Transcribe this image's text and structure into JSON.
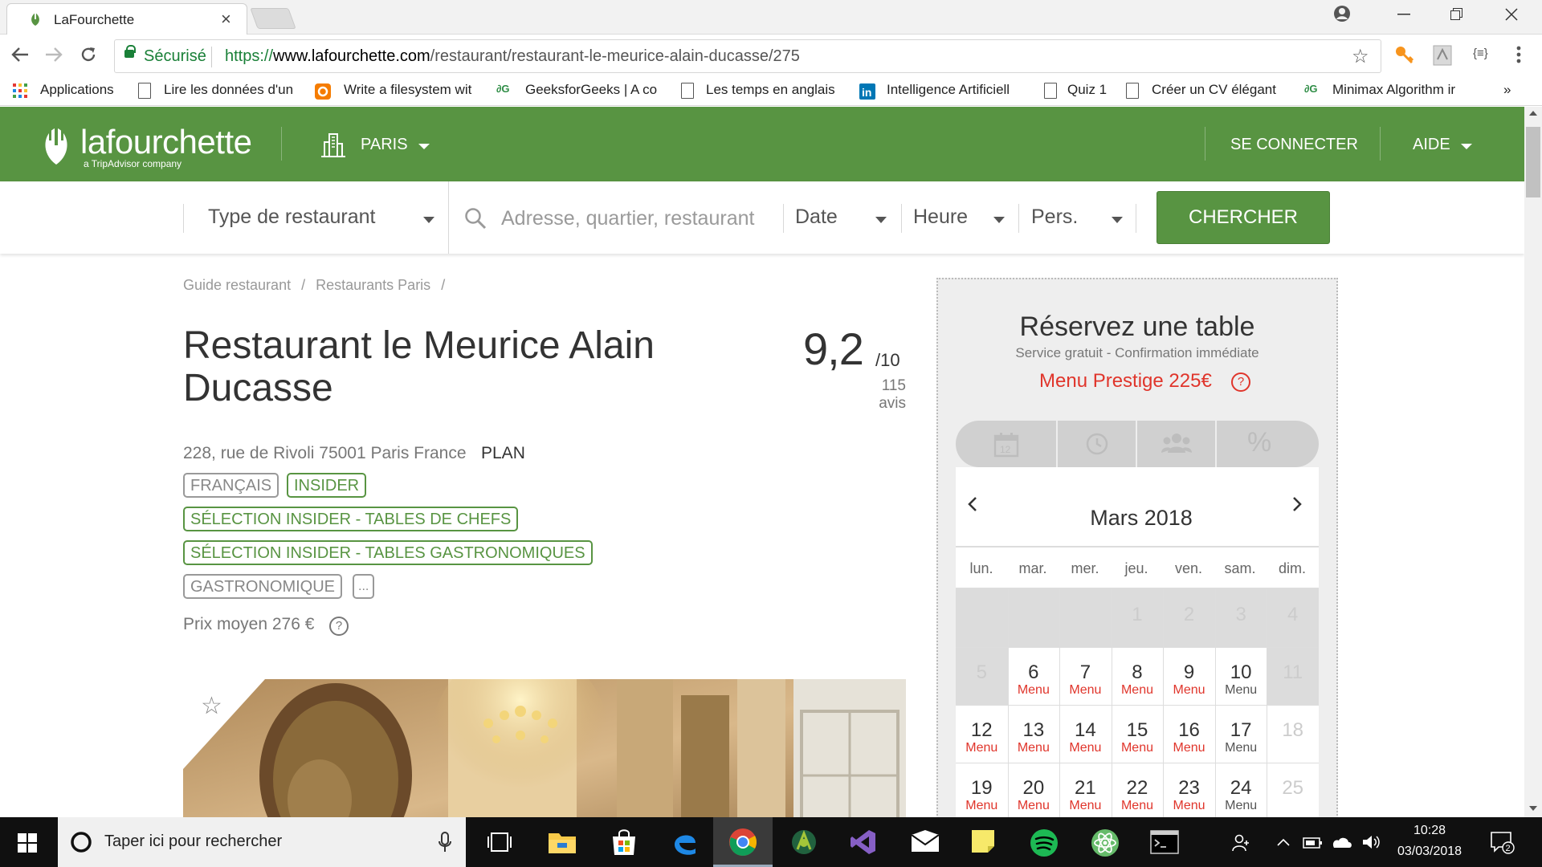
{
  "browser": {
    "tab_title": "LaFourchette",
    "tab_close": "×",
    "secure_label": "Sécurisé",
    "url_scheme": "https://",
    "url_host": "www.lafourchette.com",
    "url_path": "/restaurant/restaurant-le-meurice-alain-ducasse/275",
    "more_bookmarks": "»",
    "bookmarks": [
      {
        "label": "Applications",
        "icon": "apps-grid-icon"
      },
      {
        "label": "Lire les données d'un",
        "icon": "page-icon"
      },
      {
        "label": "Write a filesystem wit",
        "icon": "orange-ext-icon"
      },
      {
        "label": "GeeksforGeeks | A co",
        "icon": "geeksforgeeks-icon"
      },
      {
        "label": "Les temps en anglais",
        "icon": "page-icon"
      },
      {
        "label": "Intelligence Artificiell",
        "icon": "linkedin-icon"
      },
      {
        "label": "Quiz 1",
        "icon": "page-icon"
      },
      {
        "label": "Créer un CV élégant",
        "icon": "page-icon"
      },
      {
        "label": "Minimax Algorithm ir",
        "icon": "geeksforgeeks-icon"
      }
    ]
  },
  "header": {
    "logo_text": "lafourchette",
    "logo_sub": "a TripAdvisor company",
    "city": "PARIS",
    "login": "SE CONNECTER",
    "help": "AIDE",
    "brand_color": "#589442"
  },
  "search": {
    "type_label": "Type de restaurant",
    "placeholder": "Adresse, quartier, restaurant",
    "date_label": "Date",
    "time_label": "Heure",
    "pers_label": "Pers.",
    "button": "CHERCHER"
  },
  "breadcrumb": [
    "Guide restaurant",
    "/",
    "Restaurants Paris",
    "/"
  ],
  "restaurant": {
    "name": "Restaurant le Meurice Alain Ducasse",
    "rating": "9,2",
    "rating_max": "/10",
    "reviews": "115 avis",
    "address": "228, rue de Rivoli 75001 Paris France",
    "plan": "PLAN",
    "tags": [
      {
        "label": "FRANÇAIS",
        "style": "grey"
      },
      {
        "label": "INSIDER",
        "style": "green"
      },
      {
        "label": "SÉLECTION INSIDER - TABLES DE CHEFS",
        "style": "green"
      },
      {
        "label": "SÉLECTION INSIDER - TABLES GASTRONOMIQUES",
        "style": "green"
      },
      {
        "label": "GASTRONOMIQUE",
        "style": "grey"
      },
      {
        "label": "...",
        "style": "grey"
      }
    ],
    "price": "Prix moyen 276 €",
    "help_glyph": "?"
  },
  "booking": {
    "title": "Réservez une table",
    "subtitle": "Service gratuit - Confirmation immédiate",
    "menu": "Menu Prestige 225€",
    "step_icons": [
      "calendar-icon",
      "clock-icon",
      "people-icon",
      "percent-icon"
    ],
    "calendar_step_label": "12",
    "percent_label": "%",
    "month": "Mars 2018",
    "prev": "‹",
    "next": "›",
    "weekdays": [
      "lun.",
      "mar.",
      "mer.",
      "jeu.",
      "ven.",
      "sam.",
      "dim."
    ],
    "weeks": [
      [
        {
          "d": "",
          "s": "empty"
        },
        {
          "d": "",
          "s": "empty"
        },
        {
          "d": "",
          "s": "empty"
        },
        {
          "d": "1",
          "s": "disabled"
        },
        {
          "d": "2",
          "s": "disabled"
        },
        {
          "d": "3",
          "s": "disabled"
        },
        {
          "d": "4",
          "s": "disabled"
        }
      ],
      [
        {
          "d": "5",
          "s": "disabled"
        },
        {
          "d": "6",
          "m": "Menu",
          "s": "red"
        },
        {
          "d": "7",
          "m": "Menu",
          "s": "red"
        },
        {
          "d": "8",
          "m": "Menu",
          "s": "red"
        },
        {
          "d": "9",
          "m": "Menu",
          "s": "red"
        },
        {
          "d": "10",
          "m": "Menu",
          "s": "grey"
        },
        {
          "d": "11",
          "s": "disabled"
        }
      ],
      [
        {
          "d": "12",
          "m": "Menu",
          "s": "red"
        },
        {
          "d": "13",
          "m": "Menu",
          "s": "red"
        },
        {
          "d": "14",
          "m": "Menu",
          "s": "red"
        },
        {
          "d": "15",
          "m": "Menu",
          "s": "red"
        },
        {
          "d": "16",
          "m": "Menu",
          "s": "red"
        },
        {
          "d": "17",
          "m": "Menu",
          "s": "grey"
        },
        {
          "d": "18",
          "s": "disabled-white"
        }
      ],
      [
        {
          "d": "19",
          "m": "Menu",
          "s": "red"
        },
        {
          "d": "20",
          "m": "Menu",
          "s": "red"
        },
        {
          "d": "21",
          "m": "Menu",
          "s": "red"
        },
        {
          "d": "22",
          "m": "Menu",
          "s": "red"
        },
        {
          "d": "23",
          "m": "Menu",
          "s": "red"
        },
        {
          "d": "24",
          "m": "Menu",
          "s": "grey"
        },
        {
          "d": "25",
          "s": "disabled-white"
        }
      ]
    ]
  },
  "taskbar": {
    "search_placeholder": "Taper ici pour rechercher",
    "time": "10:28",
    "date": "03/03/2018",
    "notification_count": "2"
  }
}
